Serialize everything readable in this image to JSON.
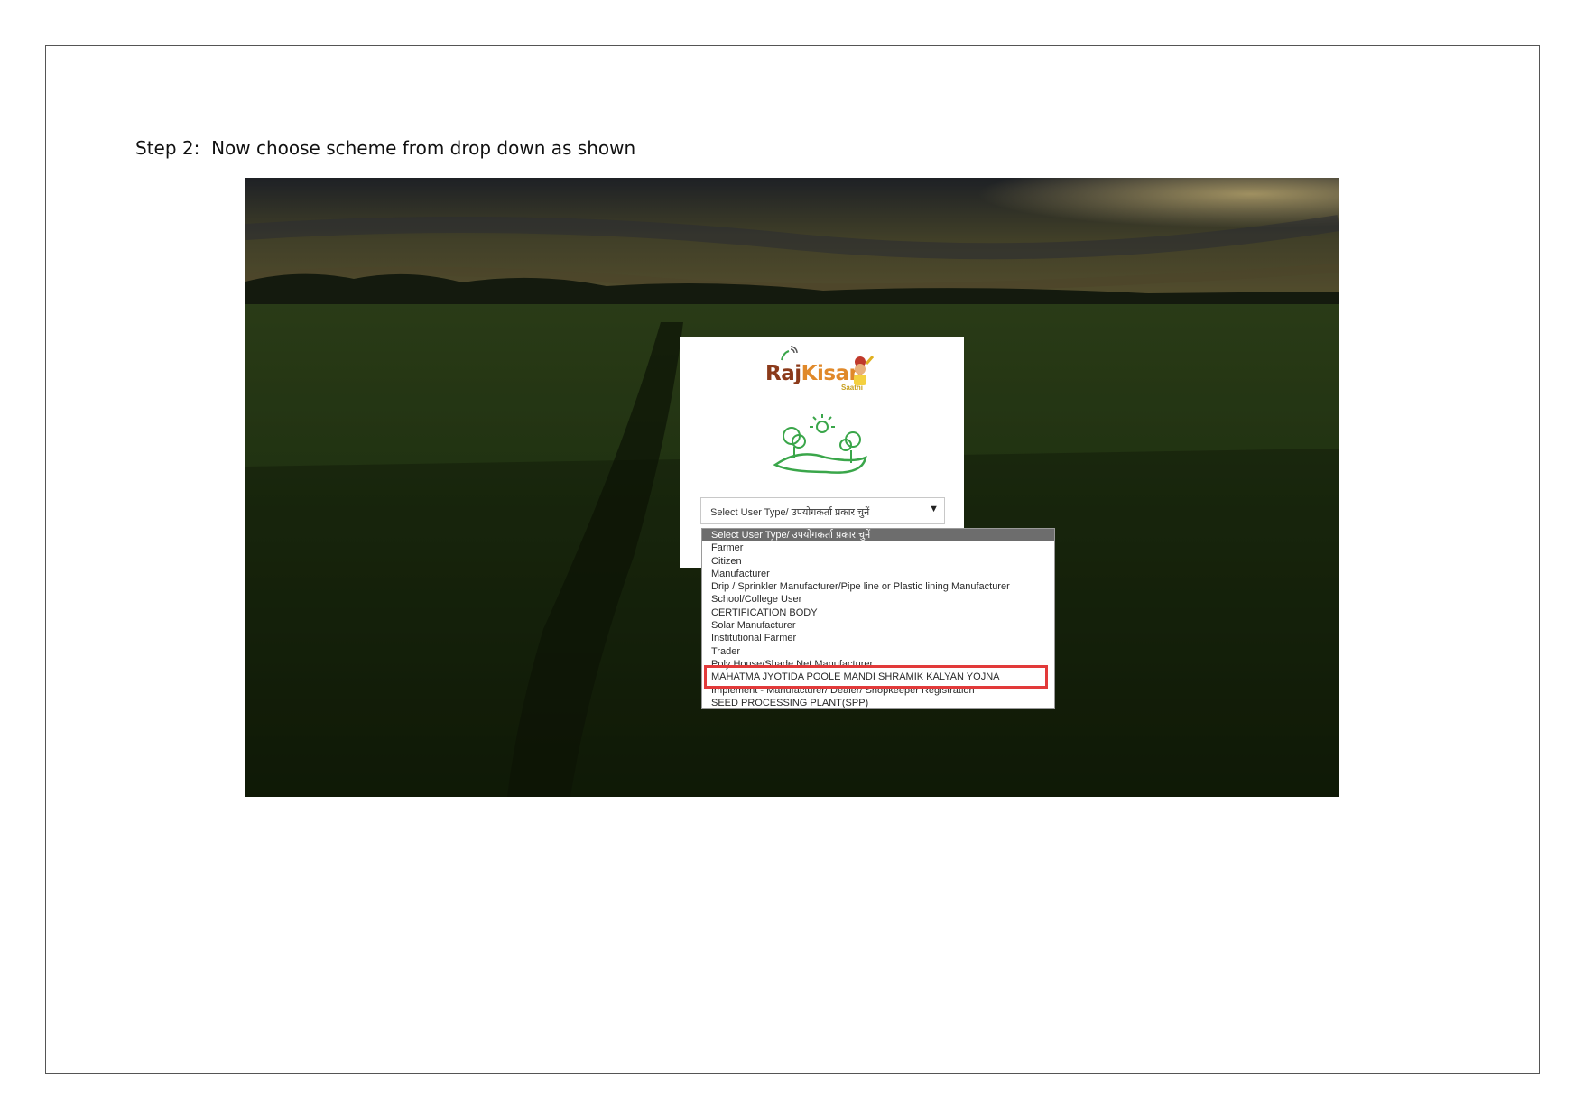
{
  "caption": "Step 2:  Now choose scheme from drop down as shown",
  "logo": {
    "raj": "Raj",
    "kisan": "Kisan",
    "sub": "Saathi"
  },
  "select": {
    "current": "Select User Type/ उपयोगकर्ता प्रकार चुनें"
  },
  "dropdown": {
    "options": [
      "Select User Type/ उपयोगकर्ता प्रकार चुनें",
      "Farmer",
      "Citizen",
      "Manufacturer",
      "Drip / Sprinkler Manufacturer/Pipe line or Plastic lining Manufacturer",
      "School/College User",
      "CERTIFICATION BODY",
      "Solar Manufacturer",
      "Institutional Farmer",
      "Trader",
      "Poly House/Shade Net Manufacturer",
      "MAHATMA JYOTIDA POOLE MANDI SHRAMIK KALYAN YOJNA",
      "Implement - Manufacturer/ Dealer/ Shopkeeper Registration",
      "SEED PROCESSING PLANT(SPP)"
    ]
  },
  "colors": {
    "highlight": "#e23a3a",
    "selected_option": "#6d6d6d",
    "logo_raj": "#8b3a1a",
    "logo_kisan": "#e0892a",
    "illustration": "#3aa64a"
  }
}
